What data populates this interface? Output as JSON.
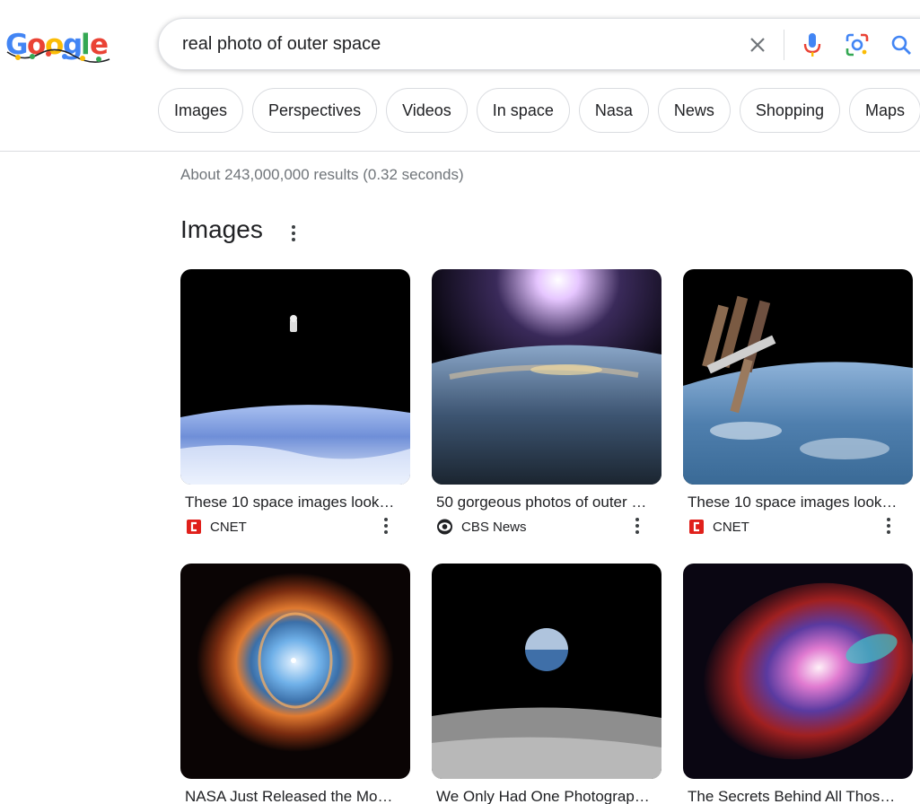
{
  "search": {
    "query": "real photo of outer space"
  },
  "logo": {
    "alt": "Google"
  },
  "chips": [
    {
      "label": "Images"
    },
    {
      "label": "Perspectives"
    },
    {
      "label": "Videos"
    },
    {
      "label": "In space"
    },
    {
      "label": "Nasa"
    },
    {
      "label": "News"
    },
    {
      "label": "Shopping"
    },
    {
      "label": "Maps"
    }
  ],
  "result_stats": "About 243,000,000 results (0.32 seconds)",
  "images_section": {
    "title": "Images",
    "cards": [
      {
        "caption": "These 10 space images look…",
        "source": "CNET",
        "source_icon": "cnet-logo"
      },
      {
        "caption": "50 gorgeous photos of outer …",
        "source": "CBS News",
        "source_icon": "cbs-eye-logo"
      },
      {
        "caption": "These 10 space images look…",
        "source": "CNET",
        "source_icon": "cnet-logo"
      },
      {
        "caption": "NASA Just Released the Mo…",
        "source": "",
        "source_icon": ""
      },
      {
        "caption": "We Only Had One Photograp…",
        "source": "",
        "source_icon": ""
      },
      {
        "caption": "The Secrets Behind All Thos…",
        "source": "",
        "source_icon": ""
      }
    ]
  },
  "colors": {
    "google_blue": "#4285f4",
    "google_red": "#ea4335",
    "google_yellow": "#fbbc05",
    "google_green": "#34a853",
    "cnet_red": "#e0201b",
    "chip_border": "#dadce0"
  }
}
